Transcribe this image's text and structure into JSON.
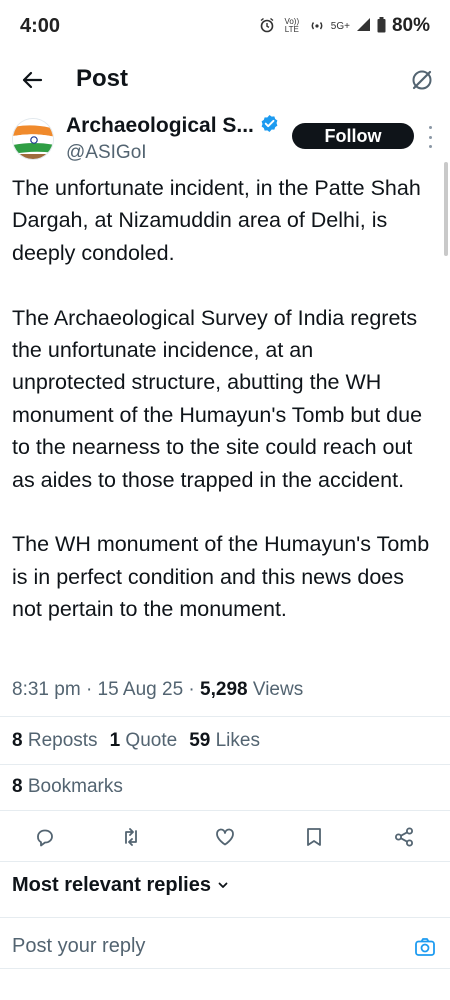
{
  "status": {
    "time": "4:00",
    "network": "5G+",
    "volte": "Vo)) LTE",
    "battery": "80%"
  },
  "header": {
    "title": "Post"
  },
  "author": {
    "name": "Archaeological S...",
    "handle": "@ASIGoI",
    "verified": true,
    "follow_label": "Follow"
  },
  "tweet": {
    "paragraphs": [
      "The unfortunate incident, in the Patte Shah Dargah, at Nizamuddin area of Delhi, is deeply condoled.",
      "The Archaeological Survey of India regrets the unfortunate incidence, at an unprotected structure, abutting the WH monument of the Humayun's Tomb but due to the nearness to the site could reach out as aides to those trapped in the accident.",
      "The WH monument of the Humayun's Tomb is in perfect condition and this news does not pertain to the monument."
    ],
    "time": "8:31 pm",
    "date": "15 Aug 25",
    "views_count": "5,298",
    "views_label": "Views"
  },
  "stats": {
    "reposts_count": "8",
    "reposts_label": "Reposts",
    "quotes_count": "1",
    "quotes_label": "Quote",
    "likes_count": "59",
    "likes_label": "Likes",
    "bookmarks_count": "8",
    "bookmarks_label": "Bookmarks"
  },
  "actions": {
    "icons": [
      "reply-icon",
      "repost-icon",
      "like-icon",
      "bookmark-icon",
      "share-icon"
    ]
  },
  "replies": {
    "sort_label": "Most relevant replies",
    "input_placeholder": "Post your reply"
  },
  "colors": {
    "text": "#0f1419",
    "secondary": "#536471",
    "accent": "#1d9bf0",
    "follow_bg": "#0f1419"
  }
}
